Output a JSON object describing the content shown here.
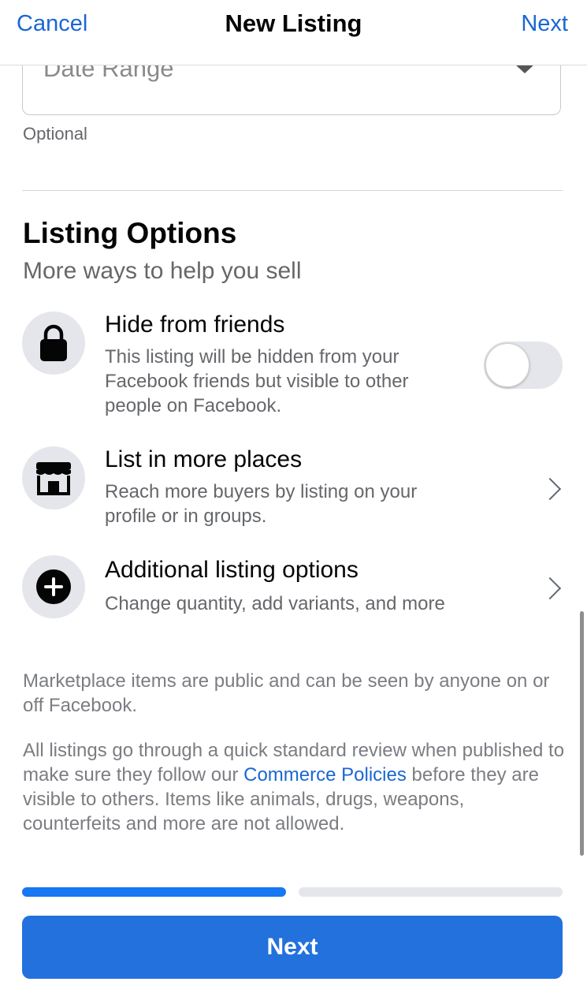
{
  "navbar": {
    "cancel_label": "Cancel",
    "title": "New Listing",
    "next_label": "Next"
  },
  "date_field": {
    "placeholder": "Date Range",
    "helper": "Optional"
  },
  "listing_options": {
    "title": "Listing Options",
    "subtitle": "More ways to help you sell",
    "items": [
      {
        "icon": "lock-icon",
        "title": "Hide from friends",
        "description": "This listing will be hidden from your Facebook friends but visible to other people on Facebook.",
        "control": "toggle",
        "toggle_on": false
      },
      {
        "icon": "storefront-icon",
        "title": "List in more places",
        "description": "Reach more buyers by listing on your profile or in groups.",
        "control": "chevron"
      },
      {
        "icon": "plus-circle-icon",
        "title": "Additional listing options",
        "description": "Change quantity, add variants, and more",
        "control": "chevron"
      }
    ]
  },
  "notices": {
    "public": "Marketplace items are public and can be seen by anyone on or off Facebook.",
    "review_before": "All listings go through a quick standard review when published to make sure they follow our ",
    "review_link": "Commerce Policies",
    "review_after": " before they are visible to others. Items like animals, drugs, weapons, counterfeits and more are not allowed."
  },
  "progress": {
    "current_step": 1,
    "total_steps": 2,
    "active_color": "#1877f2",
    "inactive_color": "#e4e6eb"
  },
  "footer": {
    "next_label": "Next"
  },
  "colors": {
    "accent": "#1a67d2",
    "button": "#2271dd"
  }
}
